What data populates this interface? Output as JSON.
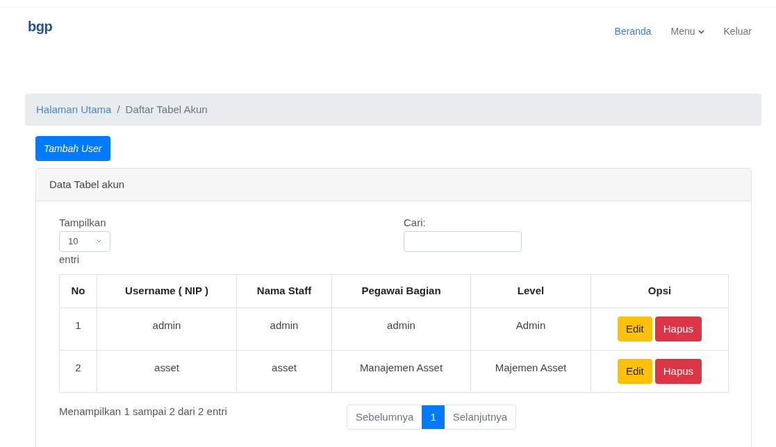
{
  "navbar": {
    "logo": "bgp",
    "links": [
      {
        "label": "Beranda",
        "kind": "link"
      },
      {
        "label": "Menu",
        "kind": "dropdown"
      },
      {
        "label": "Keluar",
        "kind": "link"
      }
    ]
  },
  "breadcrumb_separator": "/",
  "breadcrumb": [
    {
      "label": "Halaman Utama",
      "kind": "link"
    },
    {
      "label": "Daftar Tabel Akun",
      "kind": "current"
    }
  ],
  "add_button": "Tambah User",
  "card": {
    "title": "Data Tabel akun",
    "length": {
      "label_before": "Tampilkan",
      "value": "10",
      "label_after": "entri"
    },
    "search": {
      "label": "Cari:"
    },
    "table": {
      "columns": [
        "No",
        "Username ( NIP )",
        "Nama Staff",
        "Pegawai Bagian",
        "Level",
        "Opsi"
      ],
      "rows": [
        {
          "cells": [
            "1",
            "admin",
            "admin",
            "admin",
            "Admin"
          ],
          "actions": [
            "Edit",
            "Hapus"
          ]
        },
        {
          "cells": [
            "2",
            "asset",
            "asset",
            "Manajemen Asset",
            "Majemen Asset"
          ],
          "actions": [
            "Edit",
            "Hapus"
          ]
        }
      ]
    },
    "info": "Menampilkan 1 sampai 2 dari 2 entri",
    "pagination": [
      {
        "label": "Sebelumnya",
        "selected": false
      },
      {
        "label": "1",
        "selected": true
      },
      {
        "label": "Selanjutnya",
        "selected": false
      }
    ]
  }
}
